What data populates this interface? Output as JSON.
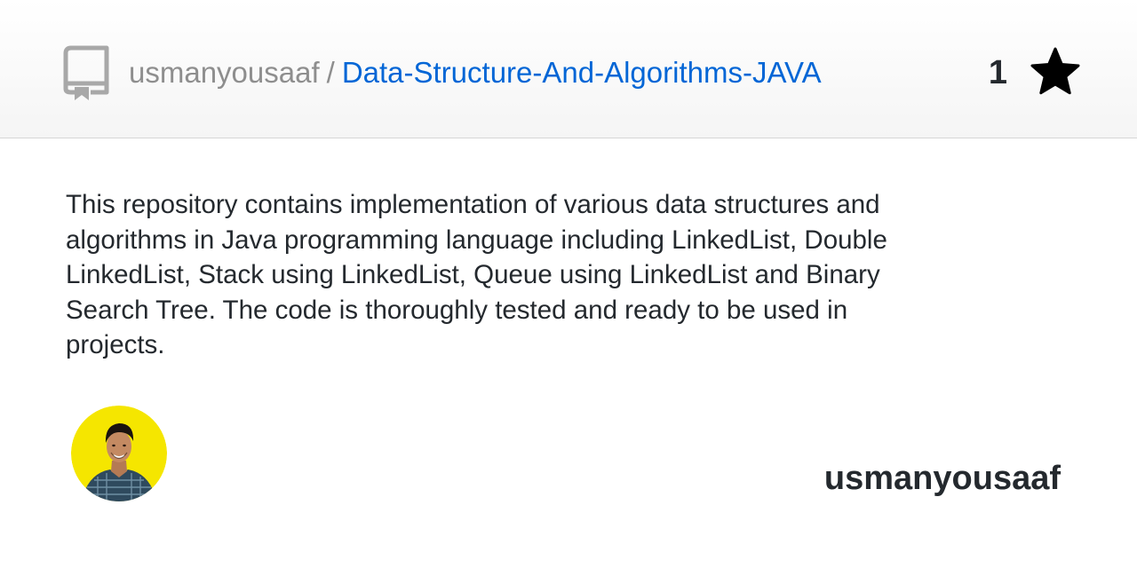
{
  "header": {
    "owner": "usmanyousaaf",
    "separator": "/",
    "repo_name": "Data-Structure-And-Algorithms-JAVA",
    "star_count": "1",
    "repo_icon": "repo-icon",
    "star_icon": "star-icon"
  },
  "description": "This repository contains implementation of various data structures and algorithms in Java programming language including LinkedList, Double LinkedList, Stack using LinkedList, Queue using LinkedList and Binary Search Tree. The code is thoroughly tested and ready to be used in projects.",
  "footer": {
    "username": "usmanyousaaf",
    "avatar": "avatar"
  },
  "colors": {
    "link": "#0366d6",
    "muted": "#8e8e8e",
    "text": "#24292e",
    "avatar_background": "#f5e600"
  }
}
